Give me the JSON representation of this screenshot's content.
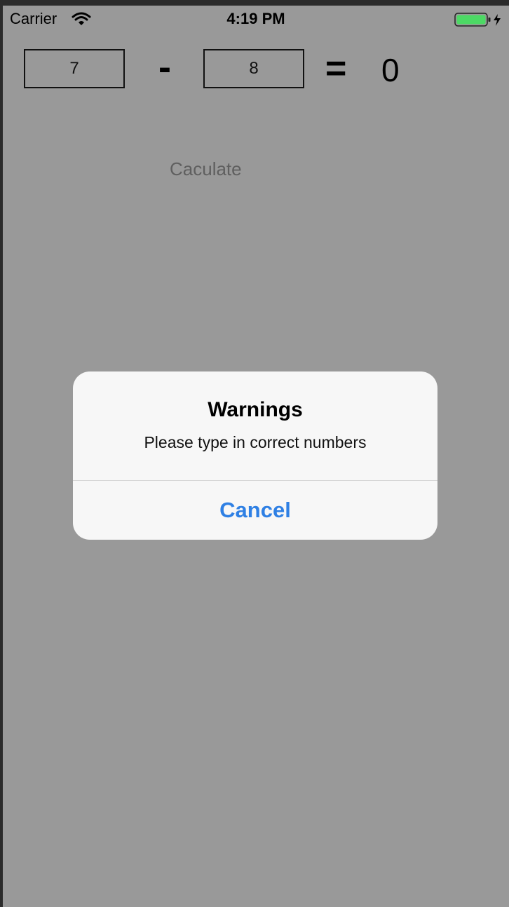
{
  "status_bar": {
    "carrier": "Carrier",
    "time": "4:19 PM",
    "wifi_icon": "wifi-icon",
    "battery_icon": "battery-charging-icon",
    "battery_color": "#4cd964"
  },
  "calculator": {
    "operand_a": "7",
    "operator": "-",
    "operand_b": "8",
    "equals": "=",
    "result": "0",
    "calculate_label": "Caculate"
  },
  "alert": {
    "title": "Warnings",
    "message": "Please type in correct numbers",
    "cancel_label": "Cancel",
    "accent_color": "#2f80e4"
  },
  "colors": {
    "dimmed_background": "#999999",
    "alert_background": "#f7f7f7"
  }
}
